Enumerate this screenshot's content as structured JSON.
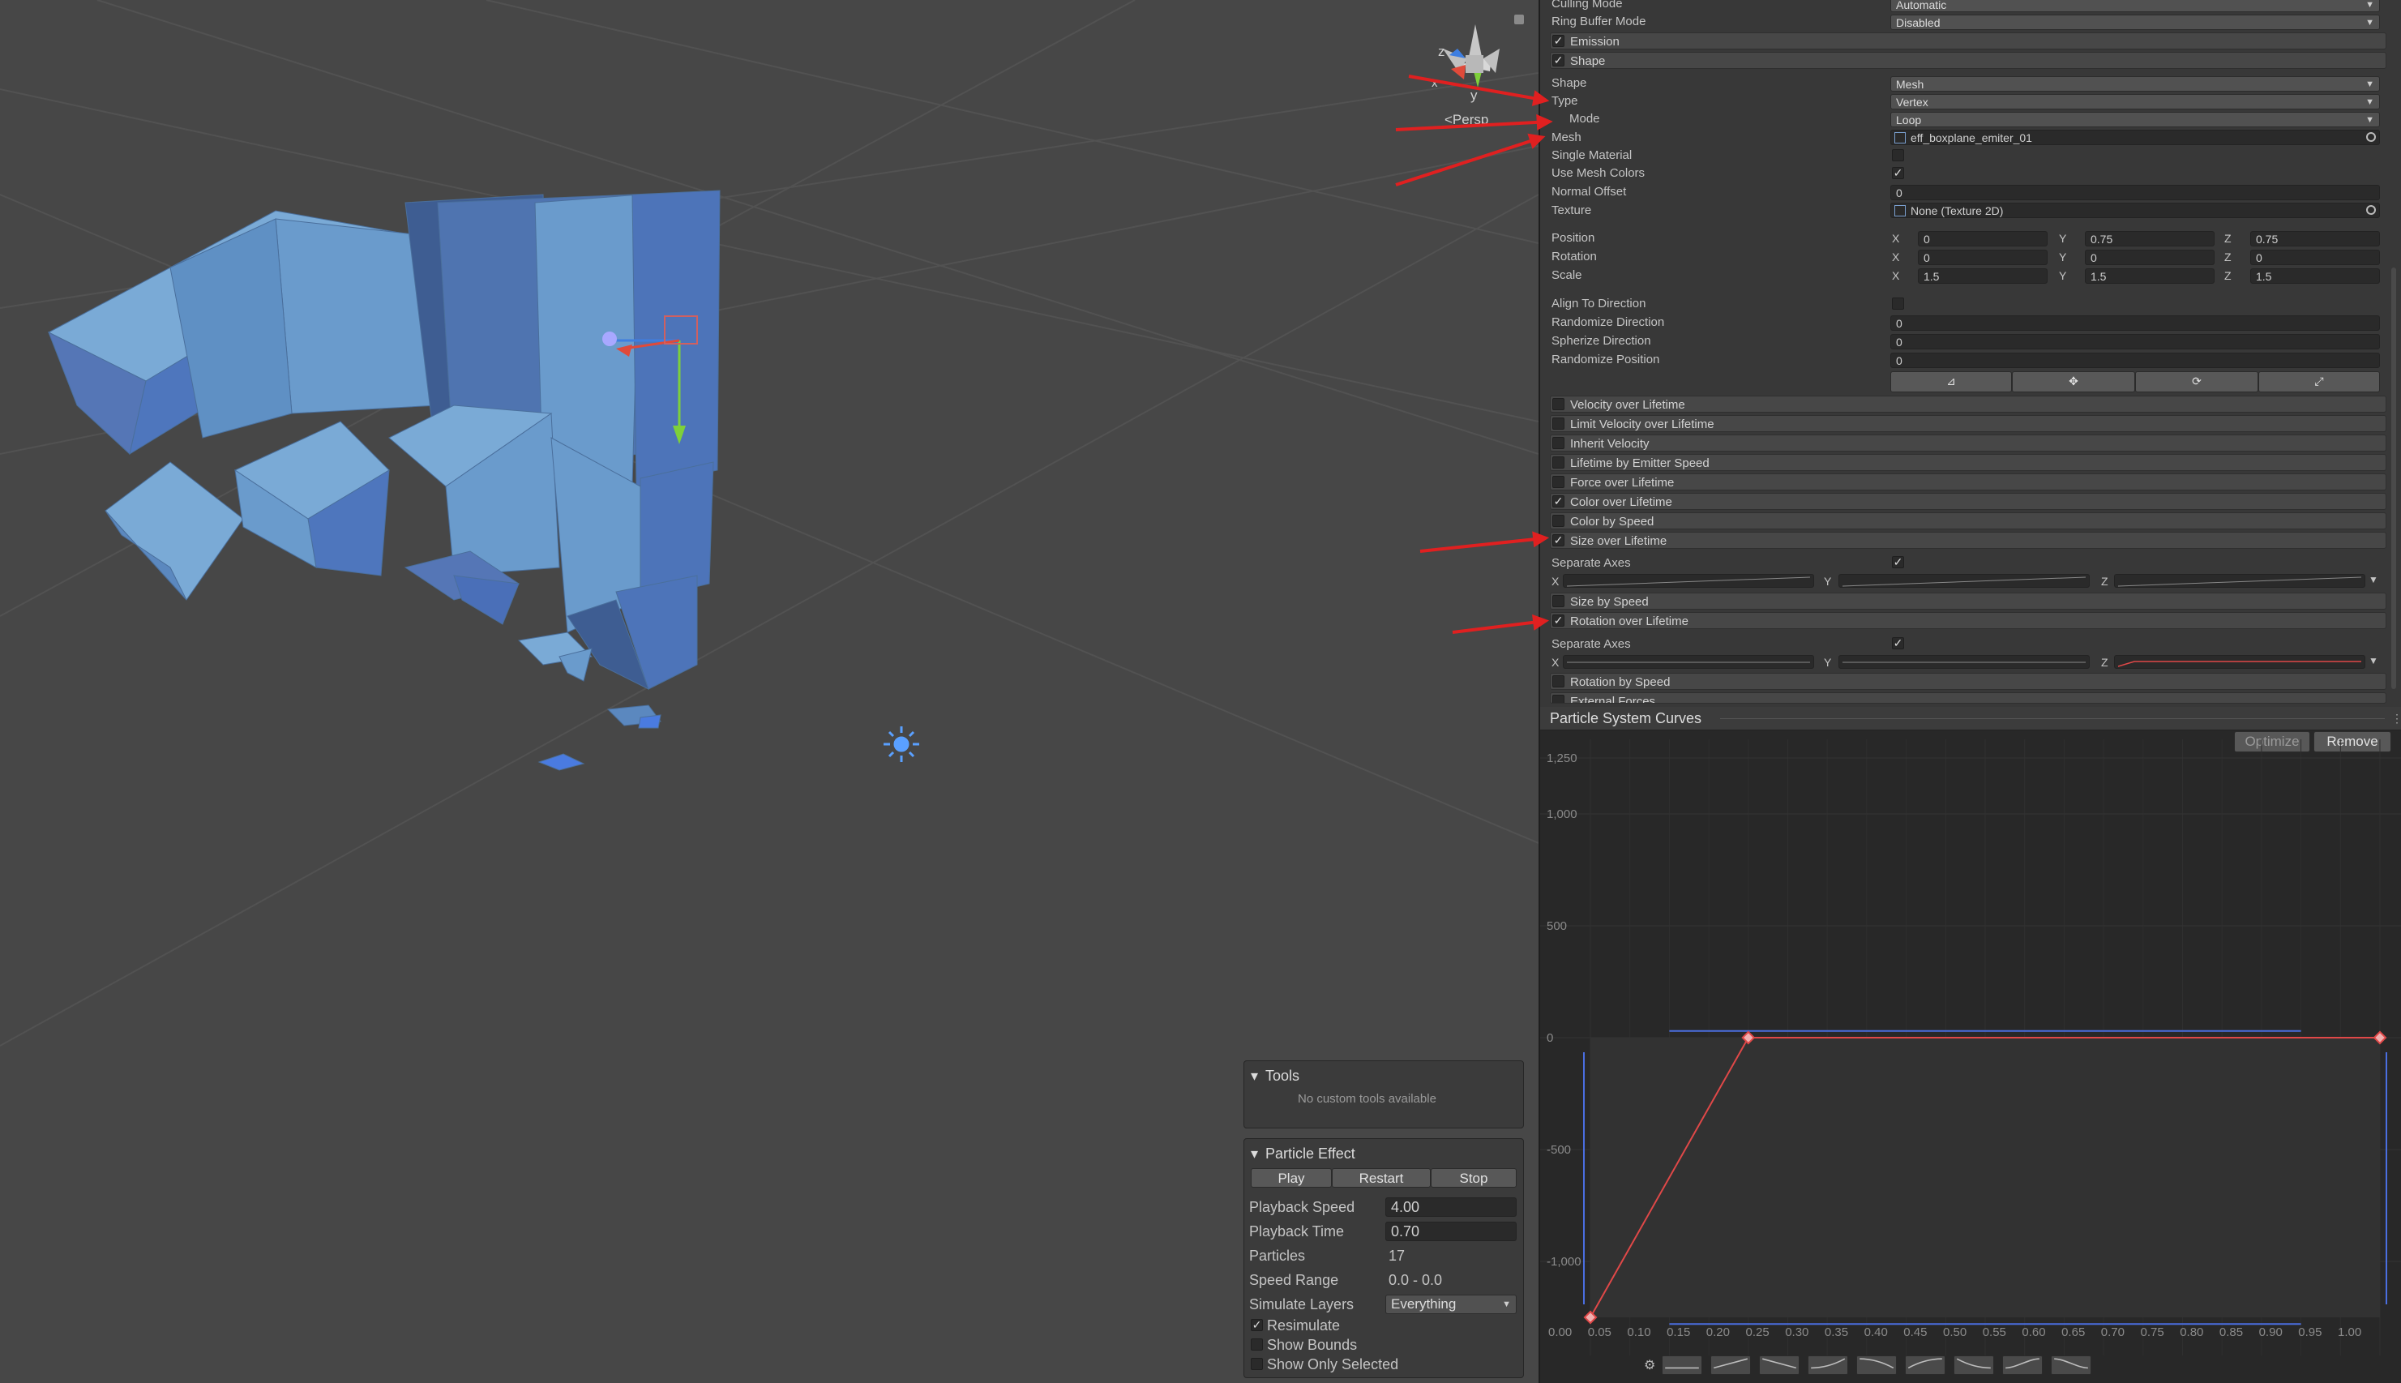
{
  "scene": {
    "persp_label": "<Persp",
    "gizmo_axes": {
      "x": "x",
      "y": "y",
      "z": "z"
    }
  },
  "inspector": {
    "top_rows": [
      {
        "label": "Culling Mode",
        "value": "Automatic"
      },
      {
        "label": "Ring Buffer Mode",
        "value": "Disabled"
      }
    ],
    "emission_module": {
      "label": "Emission",
      "enabled": true
    },
    "shape_module": {
      "label": "Shape",
      "enabled": true
    },
    "shape_rows": {
      "shape": {
        "label": "Shape",
        "value": "Mesh"
      },
      "type": {
        "label": "Type",
        "value": "Vertex"
      },
      "mode": {
        "label": "Mode",
        "value": "Loop"
      },
      "mesh": {
        "label": "Mesh",
        "value": "eff_boxplane_emiter_01"
      },
      "single_material": {
        "label": "Single Material",
        "checked": false
      },
      "use_mesh_colors": {
        "label": "Use Mesh Colors",
        "checked": true
      },
      "normal_offset": {
        "label": "Normal Offset",
        "value": "0"
      },
      "texture": {
        "label": "Texture",
        "value": "None (Texture 2D)"
      },
      "position": {
        "label": "Position",
        "x": "0",
        "y": "0.75",
        "z": "0.75"
      },
      "rotation": {
        "label": "Rotation",
        "x": "0",
        "y": "0",
        "z": "0"
      },
      "scale": {
        "label": "Scale",
        "x": "1.5",
        "y": "1.5",
        "z": "1.5"
      },
      "align_to_direction": {
        "label": "Align To Direction",
        "checked": false
      },
      "randomize_direction": {
        "label": "Randomize Direction",
        "value": "0"
      },
      "spherize_direction": {
        "label": "Spherize Direction",
        "value": "0"
      },
      "randomize_position": {
        "label": "Randomize Position",
        "value": "0"
      }
    },
    "axis_letters": {
      "x": "X",
      "y": "Y",
      "z": "Z"
    },
    "modules": [
      {
        "label": "Velocity over Lifetime",
        "enabled": false
      },
      {
        "label": "Limit Velocity over Lifetime",
        "enabled": false
      },
      {
        "label": "Inherit Velocity",
        "enabled": false
      },
      {
        "label": "Lifetime by Emitter Speed",
        "enabled": false
      },
      {
        "label": "Force over Lifetime",
        "enabled": false
      },
      {
        "label": "Color over Lifetime",
        "enabled": true
      },
      {
        "label": "Color by Speed",
        "enabled": false
      },
      {
        "label": "Size over Lifetime",
        "enabled": true
      }
    ],
    "size_separate_axes": {
      "label": "Separate Axes",
      "checked": true
    },
    "size_by_speed": {
      "label": "Size by Speed",
      "enabled": false
    },
    "rotation_over_lifetime": {
      "label": "Rotation over Lifetime",
      "enabled": true
    },
    "rotation_separate_axes": {
      "label": "Separate Axes",
      "checked": true
    },
    "rotation_by_speed": {
      "label": "Rotation by Speed",
      "enabled": false
    },
    "external_forces": {
      "label": "External Forces",
      "enabled": false
    }
  },
  "curves_panel": {
    "title": "Particle System Curves",
    "optimize_label": "Optimize",
    "remove_label": "Remove",
    "y_ticks": [
      "1,250",
      "1,000",
      "500",
      "0",
      "-500",
      "-1,000"
    ],
    "x_ticks": [
      "0.00",
      "0.05",
      "0.10",
      "0.15",
      "0.20",
      "0.25",
      "0.30",
      "0.35",
      "0.40",
      "0.45",
      "0.50",
      "0.55",
      "0.60",
      "0.65",
      "0.70",
      "0.75",
      "0.80",
      "0.85",
      "0.90",
      "0.95",
      "1.00"
    ],
    "curve_keys": [
      {
        "t": 0.0,
        "v": -1250
      },
      {
        "t": 0.2,
        "v": 0
      },
      {
        "t": 1.0,
        "v": 0
      }
    ],
    "curve_color": "#e04848",
    "range_color": "#4a6ee0"
  },
  "tools_panel": {
    "title": "Tools",
    "message": "No custom tools available"
  },
  "particle_effect": {
    "title": "Particle Effect",
    "play_label": "Play",
    "restart_label": "Restart",
    "stop_label": "Stop",
    "playback_speed": {
      "label": "Playback Speed",
      "value": "4.00"
    },
    "playback_time": {
      "label": "Playback Time",
      "value": "0.70"
    },
    "particles": {
      "label": "Particles",
      "value": "17"
    },
    "speed_range": {
      "label": "Speed Range",
      "value": "0.0 - 0.0"
    },
    "simulate_layers": {
      "label": "Simulate Layers",
      "value": "Everything"
    },
    "resimulate": {
      "label": "Resimulate",
      "checked": true
    },
    "show_bounds": {
      "label": "Show Bounds",
      "checked": false
    },
    "show_only_selected": {
      "label": "Show Only Selected",
      "checked": false
    }
  },
  "colors": {
    "annotation_arrow": "#e02020",
    "cube_light": "#6a9bcc",
    "cube_dark": "#3e5d92",
    "accent_blue": "#4a7be0"
  }
}
